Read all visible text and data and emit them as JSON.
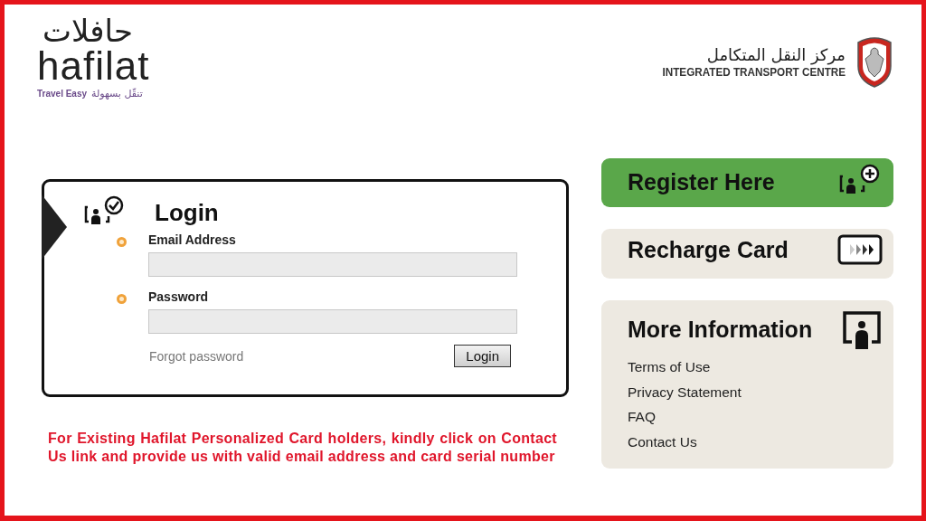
{
  "header": {
    "brand": {
      "arabic": "حافلات",
      "name": "hafilat",
      "tagline_en": "Travel Easy",
      "tagline_ar": "تنقّل بسهولة"
    },
    "agency": {
      "arabic": "مركز النقل المتكامل",
      "name": "INTEGRATED TRANSPORT CENTRE"
    }
  },
  "login": {
    "title": "Login",
    "fields": [
      {
        "label": "Email Address",
        "required": true
      },
      {
        "label": "Password",
        "required": true
      }
    ],
    "forgot_link": "Forgot password",
    "button": "Login"
  },
  "notice": "For Existing Hafilat Personalized Card holders, kindly click on Contact Us link and provide us with valid email address and card serial number",
  "side": [
    {
      "kind": "register",
      "label": "Register Here",
      "color": "#5aa74a"
    },
    {
      "kind": "recharge",
      "label": "Recharge Card",
      "color": "#ede9e1"
    },
    {
      "kind": "info",
      "label": "More Information",
      "color": "#ede9e1",
      "links": [
        "Terms of Use",
        "Privacy Statement",
        "FAQ",
        "Contact Us"
      ]
    }
  ]
}
